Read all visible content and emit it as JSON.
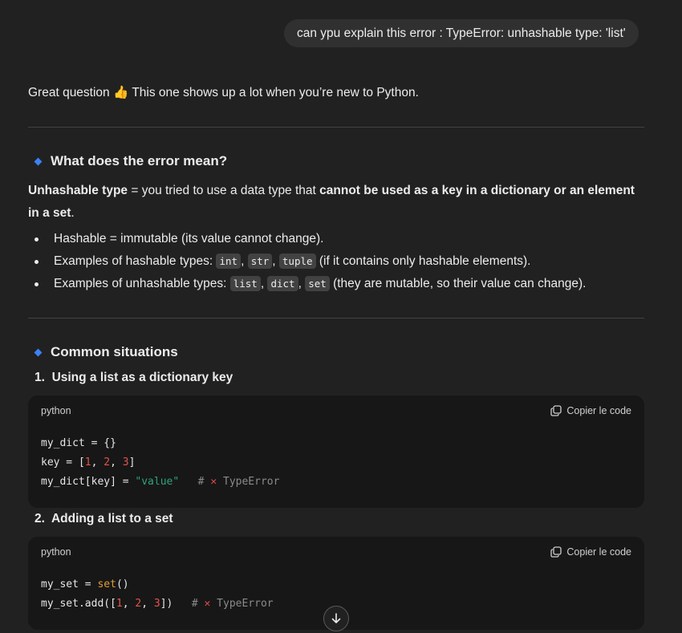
{
  "user_message": "can ypu explain this error : TypeError: unhashable type: 'list'",
  "intro": {
    "prefix": "Great question",
    "emoji": "👍",
    "suffix": "This one shows up a lot when you’re new to Python."
  },
  "section1": {
    "title": "What does the error mean?",
    "definition": {
      "term": "Unhashable type",
      "middle": " = you tried to use a data type that ",
      "bold_end": "cannot be used as a key in a dictionary or an element in a set",
      "end": "."
    },
    "bullets": [
      {
        "text": "Hashable = immutable (its value cannot change)."
      },
      {
        "prefix": "Examples of hashable types: ",
        "codes": [
          "int",
          "str",
          "tuple"
        ],
        "suffix": " (if it contains only hashable elements)."
      },
      {
        "prefix": "Examples of unhashable types: ",
        "codes": [
          "list",
          "dict",
          "set"
        ],
        "suffix": " (they are mutable, so their value can change)."
      }
    ]
  },
  "section2": {
    "title": "Common situations",
    "items": [
      {
        "number": "1.",
        "title": "Using a list as a dictionary key",
        "lang": "python",
        "copy_label": "Copier le code"
      },
      {
        "number": "2.",
        "title": "Adding a list to a set",
        "lang": "python",
        "copy_label": "Copier le code"
      }
    ]
  },
  "code1": {
    "l1": {
      "a": "my_dict = {}"
    },
    "l2": {
      "a": "key = [",
      "n1": "1",
      "c1": ", ",
      "n2": "2",
      "c2": ", ",
      "n3": "3",
      "b": "]"
    },
    "l3": {
      "a": "my_dict[key] = ",
      "s": "\"value\"",
      "sp": "   # ",
      "x": "✕",
      "cmt": " TypeError"
    }
  },
  "code2": {
    "l1": {
      "a": "my_set = ",
      "f": "set",
      "b": "()"
    },
    "l2": {
      "a": "my_set.add([",
      "n1": "1",
      "c1": ", ",
      "n2": "2",
      "c2": ", ",
      "n3": "3",
      "b": "])",
      "sp": "   # ",
      "x": "✕",
      "cmt": " TypeError"
    }
  },
  "icons": {
    "copy": "copy-icon",
    "scroll": "arrow-down-icon",
    "bullet": "diamond-icon"
  },
  "colors": {
    "background": "#212121",
    "bubble": "#303030",
    "code_bg": "#171717",
    "accent": "#3b82f6"
  }
}
